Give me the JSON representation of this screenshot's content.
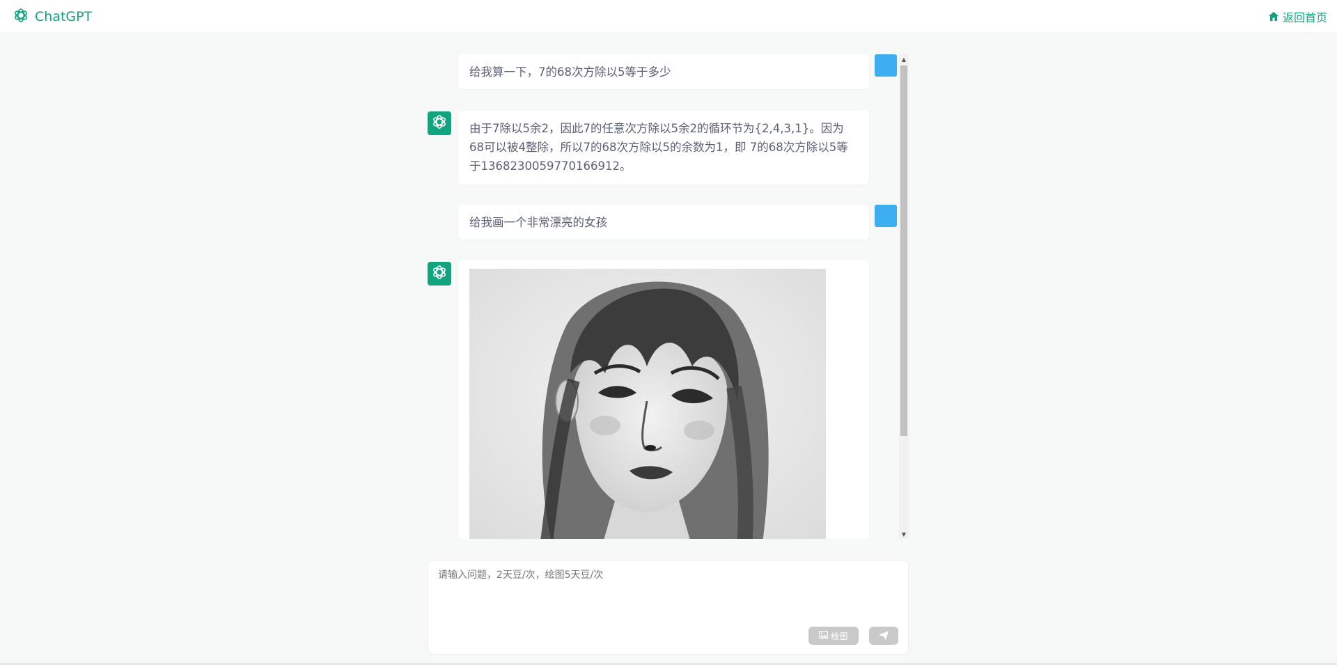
{
  "header": {
    "brand_name": "ChatGPT",
    "home_link_label": "返回首页",
    "icons": {
      "brand": "openai-logo-icon",
      "home": "home-icon"
    }
  },
  "messages": [
    {
      "role": "user",
      "text": "给我算一下，7的68次方除以5等于多少"
    },
    {
      "role": "assistant",
      "text": "由于7除以5余2，因此7的任意次方除以5余2的循环节为{2,4,3,1}。因为68可以被4整除，所以7的68次方除以5的余数为1，即 7的68次方除以5等于1368230059770166912。"
    },
    {
      "role": "user",
      "text": "给我画一个非常漂亮的女孩"
    },
    {
      "role": "assistant",
      "content_type": "image",
      "image_subject": "black-and-white sketch portrait of a girl"
    }
  ],
  "input": {
    "placeholder": "请输入问题，2天豆/次，绘图5天豆/次",
    "value": "",
    "draw_button_label": "绘图",
    "icons": {
      "draw": "image-icon",
      "send": "send-icon"
    }
  },
  "colors": {
    "brand_green": "#11a37f",
    "user_avatar": "#3daef0",
    "bot_avatar": "#12a37f",
    "disabled_button": "#c9c9c9",
    "page_background": "#f7f8f8"
  }
}
